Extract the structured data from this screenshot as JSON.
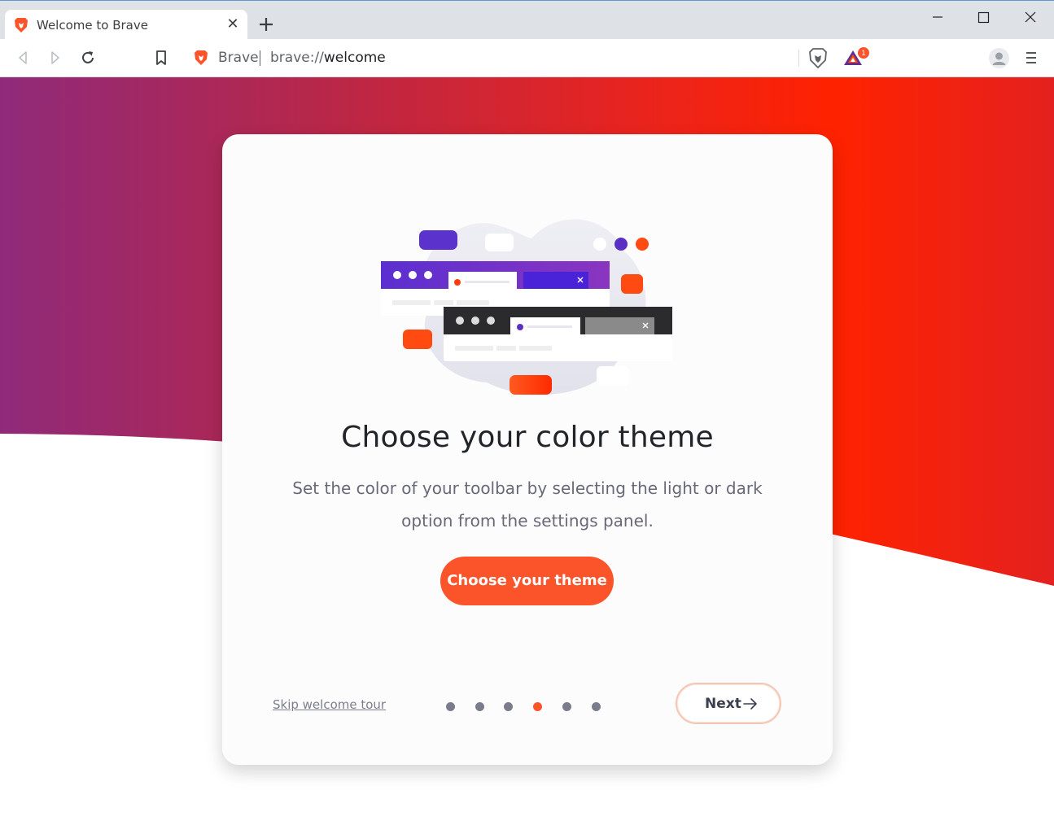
{
  "tab": {
    "title": "Welcome to Brave",
    "close": "✕"
  },
  "omnibox": {
    "site_label": "Brave",
    "url_scheme": "brave://",
    "url_path": "welcome"
  },
  "extensions": {
    "rewards_badge": "1"
  },
  "colors": {
    "brave_orange": "#fb542b",
    "gradient_purple": "#8f2a7a",
    "gradient_red": "#ff2200",
    "dot_inactive": "#7a7c8b"
  },
  "card": {
    "title": "Choose your color theme",
    "text": "Set the color of your toolbar by selecting the light or dark option from the settings panel.",
    "button": "Choose your theme"
  },
  "footer": {
    "skip": "Skip welcome tour",
    "next": "Next",
    "pager": {
      "total": 6,
      "active_index": 3
    }
  },
  "icons": [
    "brave-lion-icon",
    "close-icon",
    "plus-icon",
    "minimize-icon",
    "maximize-icon",
    "back-icon",
    "forward-icon",
    "reload-icon",
    "bookmark-icon",
    "shields-icon",
    "rewards-icon",
    "avatar-icon",
    "menu-icon",
    "arrow-right-icon"
  ]
}
